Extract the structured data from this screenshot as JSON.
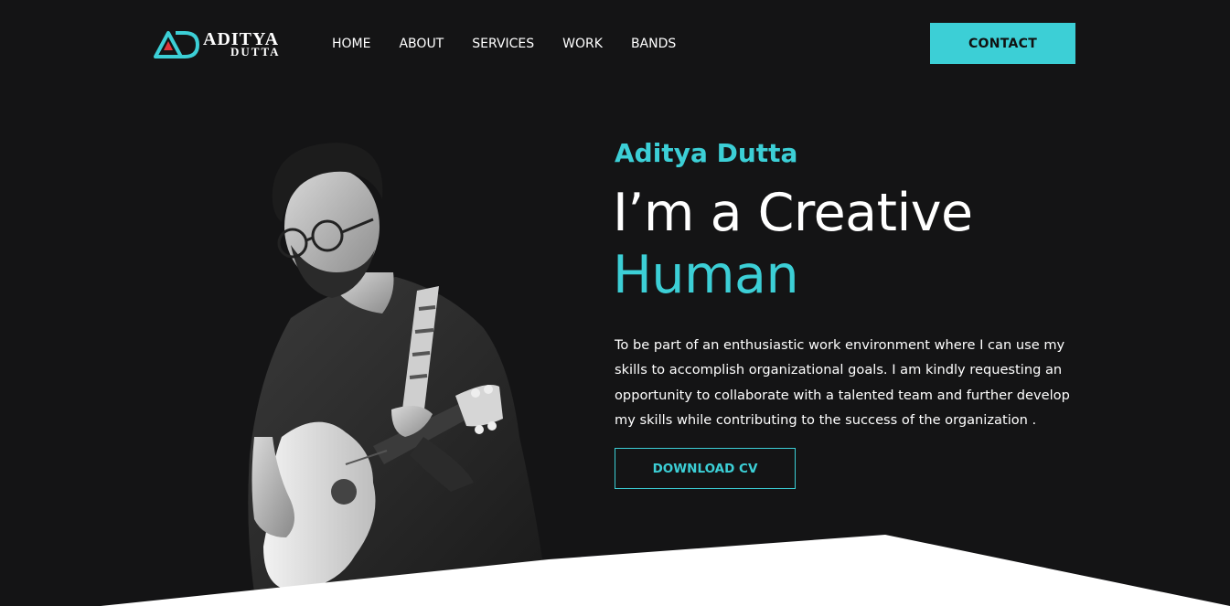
{
  "header": {
    "logo": {
      "line1": "ADITYA",
      "line2": "DUTTA",
      "mark": "AD"
    },
    "nav": [
      "HOME",
      "ABOUT",
      "SERVICES",
      "WORK",
      "BANDS"
    ],
    "contact_label": "CONTACT"
  },
  "hero": {
    "name": "Aditya Dutta",
    "headline_line1": "I’m a Creative",
    "headline_line2": "Human",
    "description_lines": [
      "To be part of an enthusiastic work environment where I can use my",
      "skills to accomplish organizational goals. I am kindly requesting an",
      "opportunity to collaborate with a talented team and further develop",
      "my skills while contributing to the success of the organization ."
    ],
    "cv_label": "DOWNLOAD CV",
    "portrait_icon": "guitarist-photo"
  },
  "colors": {
    "background": "#141415",
    "accent": "#3ccfd6",
    "text": "#ffffff",
    "logo_red": "#e0343a"
  }
}
